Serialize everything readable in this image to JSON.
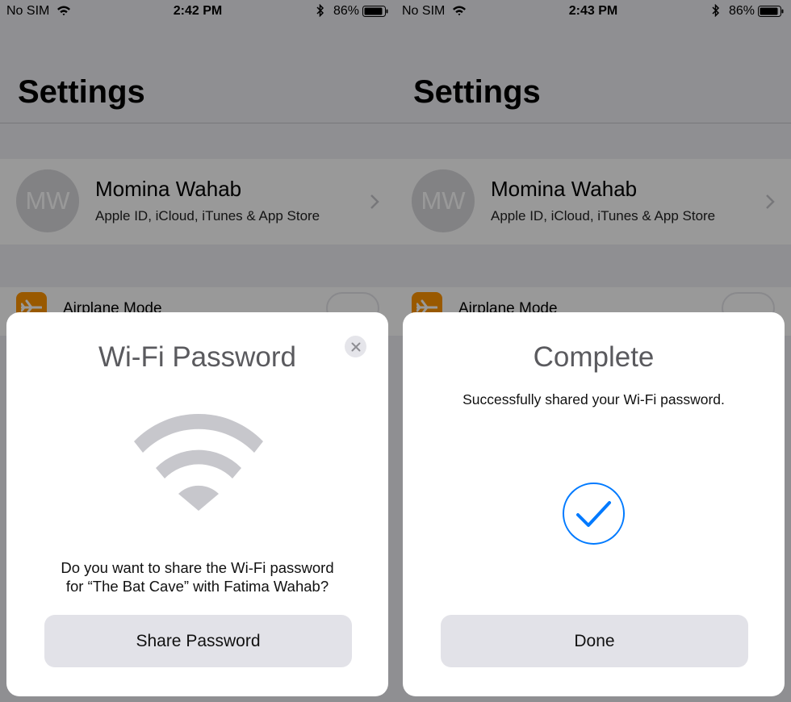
{
  "left": {
    "status": {
      "carrier": "No SIM",
      "time": "2:42 PM",
      "battery": "86%"
    },
    "title": "Settings",
    "profile": {
      "initials": "MW",
      "name": "Momina Wahab",
      "subtitle": "Apple ID, iCloud, iTunes & App Store"
    },
    "airplane_label": "Airplane Mode",
    "sheet": {
      "title": "Wi-Fi Password",
      "prompt_line1": "Do you want to share the Wi-Fi password",
      "prompt_line2": "for “The Bat Cave” with Fatima Wahab?",
      "button": "Share Password"
    }
  },
  "right": {
    "status": {
      "carrier": "No SIM",
      "time": "2:43 PM",
      "battery": "86%"
    },
    "title": "Settings",
    "profile": {
      "initials": "MW",
      "name": "Momina Wahab",
      "subtitle": "Apple ID, iCloud, iTunes & App Store"
    },
    "airplane_label": "Airplane Mode",
    "sheet": {
      "title": "Complete",
      "message": "Successfully shared your Wi-Fi password.",
      "button": "Done"
    }
  },
  "colors": {
    "accent": "#007aff",
    "airplane": "#ff9500",
    "button_bg": "#e2e2e8",
    "wifi_glyph": "#c7c7cc"
  },
  "icons": [
    "wifi-icon",
    "bluetooth-icon",
    "battery-icon",
    "chevron-right-icon",
    "airplane-icon",
    "close-icon",
    "checkmark-icon"
  ]
}
